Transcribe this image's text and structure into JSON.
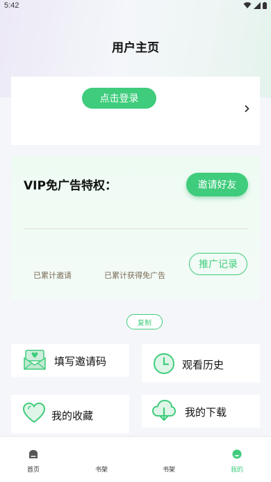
{
  "status_bar": {
    "time": "5:42"
  },
  "page_title": "用户主页",
  "login": {
    "button_label": "点击登录"
  },
  "vip": {
    "title": "VIP免广告特权：",
    "invite_button": "邀请好友",
    "promo_button": "推广记录",
    "stat_invited_label": "已累计邀请",
    "stat_adfree_label": "已累计获得免广告"
  },
  "copy_button": "复制",
  "menu": {
    "enter_invite_code": "填写邀请码",
    "watch_history": "观看历史",
    "my_favorites": "我的收藏",
    "my_downloads": "我的下载"
  },
  "nav": {
    "items": [
      {
        "label": "首页",
        "icon": "home-icon",
        "active": false
      },
      {
        "label": "书架",
        "icon": "bookshelf-icon",
        "active": false
      },
      {
        "label": "书架",
        "icon": "bookshelf-icon",
        "active": false
      },
      {
        "label": "我的",
        "icon": "profile-icon",
        "active": true
      }
    ]
  },
  "colors": {
    "accent": "#3fcc7c",
    "background": "#f4f6fa",
    "stat_text": "#7a6a55"
  }
}
